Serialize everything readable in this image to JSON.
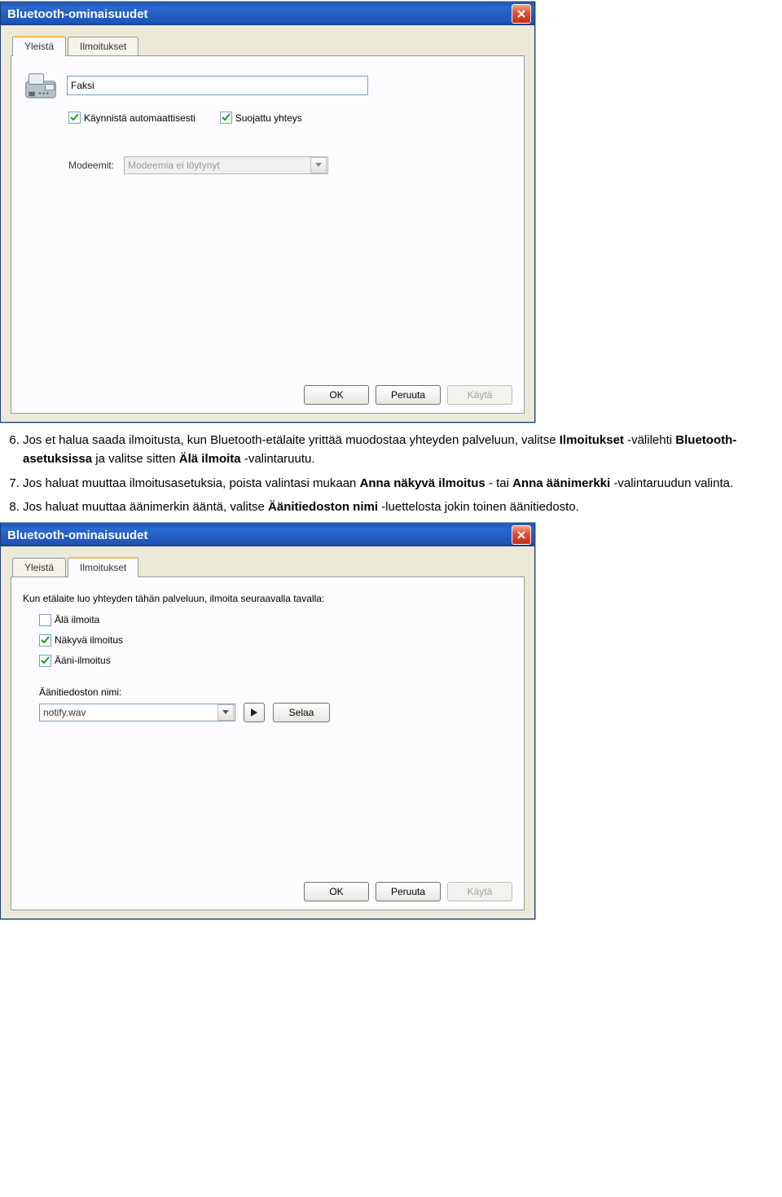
{
  "dialog1": {
    "title": "Bluetooth-ominaisuudet",
    "tabs": {
      "general": "Yleistä",
      "notifications": "Ilmoitukset"
    },
    "name_value": "Faksi",
    "check_autostart": "Käynnistä automaattisesti",
    "check_secure": "Suojattu yhteys",
    "modems_label": "Modeemit:",
    "modems_value": "Modeemia ei löytynyt",
    "ok": "OK",
    "cancel": "Peruuta",
    "apply": "Käytä"
  },
  "instructions": {
    "step6_pre": "Jos et halua saada ilmoitusta, kun Bluetooth-etälaite yrittää muodostaa yhteyden palveluun, valitse ",
    "step6_b1": "Ilmoitukset",
    "step6_mid1": "-välilehti ",
    "step6_b2": "Bluetooth-asetuksissa",
    "step6_mid2": " ja valitse sitten ",
    "step6_b3": "Älä ilmoita",
    "step6_tail": "-valintaruutu.",
    "step7_pre": "Jos haluat muuttaa ilmoitusasetuksia, poista valintasi mukaan ",
    "step7_b1": "Anna näkyvä ilmoitus",
    "step7_mid": "- tai ",
    "step7_b2": "Anna äänimerkki",
    "step7_tail": " -valintaruudun valinta.",
    "step8_pre": "Jos haluat muuttaa äänimerkin ääntä, valitse ",
    "step8_b1": "Äänitiedoston nimi",
    "step8_tail": " -luettelosta jokin toinen äänitiedosto."
  },
  "dialog2": {
    "title": "Bluetooth-ominaisuudet",
    "tabs": {
      "general": "Yleistä",
      "notifications": "Ilmoitukset"
    },
    "prompt": "Kun etälaite luo yhteyden tähän palveluun, ilmoita seuraavalla tavalla:",
    "chk_dontnotify": "Älä ilmoita",
    "chk_visual": "Näkyvä ilmoitus",
    "chk_audio": "Ääni-ilmoitus",
    "soundfile_label": "Äänitiedoston nimi:",
    "soundfile_value": "notify.wav",
    "browse": "Selaa",
    "ok": "OK",
    "cancel": "Peruuta",
    "apply": "Käytä"
  }
}
